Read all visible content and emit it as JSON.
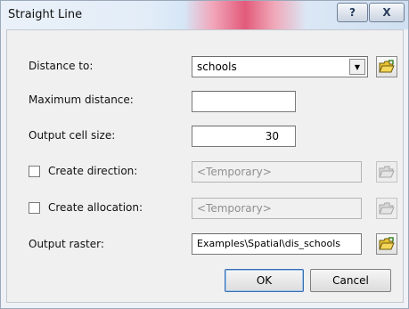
{
  "window": {
    "title": "Straight Line",
    "help_label": "?",
    "close_label": "X"
  },
  "form": {
    "distance_to": {
      "label": "Distance to:",
      "value": "schools",
      "arrow": "▼"
    },
    "maximum_distance": {
      "label": "Maximum distance:",
      "value": ""
    },
    "output_cell_size": {
      "label": "Output cell size:",
      "value": "30"
    },
    "create_direction": {
      "label": "Create direction:",
      "checked": false,
      "value": "<Temporary>"
    },
    "create_allocation": {
      "label": "Create allocation:",
      "checked": false,
      "value": "<Temporary>"
    },
    "output_raster": {
      "label": "Output raster:",
      "value": "Examples\\Spatial\\dis_schools"
    }
  },
  "buttons": {
    "ok_label": "OK",
    "cancel_label": "Cancel"
  },
  "icons": {
    "open_folder": "open-folder-icon",
    "dropdown": "chevron-down-icon"
  },
  "colors": {
    "folder_yellow": "#e8c230",
    "folder_green": "#3a8a2a"
  }
}
